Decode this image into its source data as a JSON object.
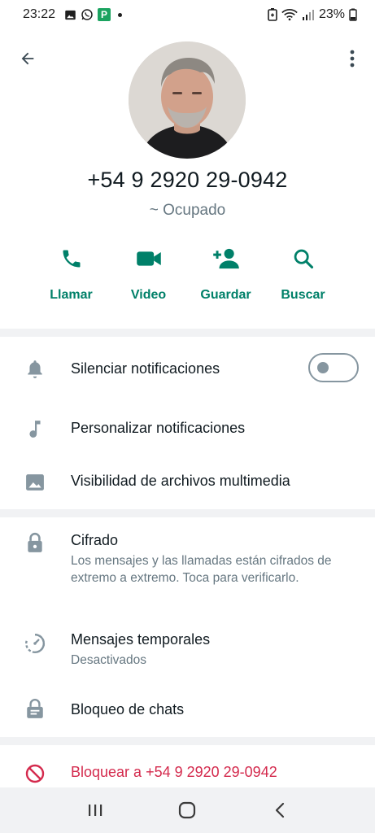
{
  "status_bar": {
    "time": "23:22",
    "battery": "23%",
    "left_icons": [
      "gallery-icon",
      "whatsapp-icon",
      "p-app-icon",
      "notification-dot"
    ],
    "right_icons": [
      "battery-saver-icon",
      "wifi-icon",
      "signal-icon",
      "battery-icon"
    ],
    "p_app_letter": "P"
  },
  "header": {
    "back_icon": "arrow-back-icon",
    "more_icon": "more-vert-icon"
  },
  "profile": {
    "phone": "+54 9 2920 29-0942",
    "about": "~ Ocupado"
  },
  "actions": [
    {
      "label": "Llamar",
      "icon": "phone-icon"
    },
    {
      "label": "Video",
      "icon": "videocam-icon"
    },
    {
      "label": "Guardar",
      "icon": "person-add-icon"
    },
    {
      "label": "Buscar",
      "icon": "search-icon"
    }
  ],
  "notifications_section": {
    "mute": {
      "title": "Silenciar notificaciones",
      "icon": "bell-icon",
      "enabled": false
    },
    "custom": {
      "title": "Personalizar notificaciones",
      "icon": "music-note-icon"
    },
    "media": {
      "title": "Visibilidad de archivos multimedia",
      "icon": "image-icon"
    }
  },
  "privacy_section": {
    "encryption": {
      "title": "Cifrado",
      "subtitle": "Los mensajes y las llamadas están cifrados de extremo a extremo. Toca para verificarlo.",
      "icon": "lock-icon"
    },
    "disappearing": {
      "title": "Mensajes temporales",
      "subtitle": "Desactivados",
      "icon": "timer-icon"
    },
    "chat_lock": {
      "title": "Bloqueo de chats",
      "icon": "chat-lock-icon"
    }
  },
  "block_section": {
    "block": {
      "title": "Bloquear a +54 9 2920 29-0942",
      "icon": "block-icon"
    }
  },
  "navbar": {
    "items": [
      "recents-icon",
      "home-icon",
      "back-icon"
    ]
  },
  "colors": {
    "accent": "#008069",
    "danger": "#d42a4d",
    "muted": "#667781"
  }
}
